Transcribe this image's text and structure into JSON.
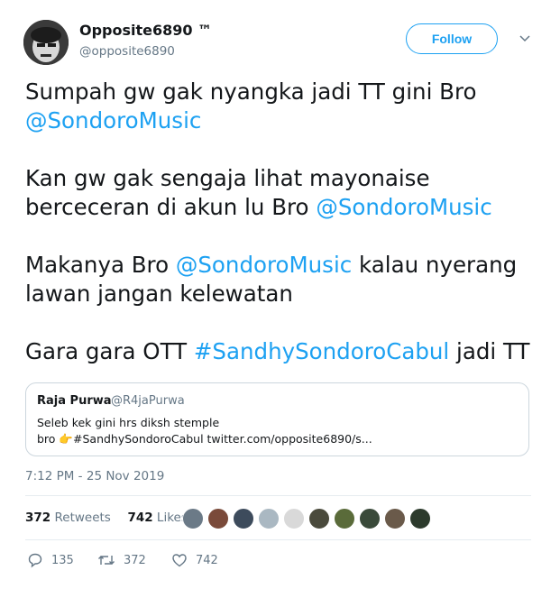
{
  "author": {
    "display_name": "Opposite6890 ™",
    "handle": "@opposite6890",
    "avatar_icon": "profile-photo"
  },
  "follow_label": "Follow",
  "tweet": {
    "line1": "Sumpah gw gak nyangka jadi TT gini Bro",
    "line1_mention": "@SondoroMusic",
    "line2a": "Kan gw gak sengaja lihat mayonaise",
    "line2b": "berceceran di akun lu Bro ",
    "line2_mention": "@SondoroMusic",
    "line3a": "Makanya Bro ",
    "line3_mention": "@SondoroMusic",
    "line3b": " kalau nyerang",
    "line3c": "lawan jangan kelewatan",
    "line4a": "Gara gara OTT ",
    "line4_hashtag": "#SandhySondoroCabul",
    "line4b": "  jadi TT"
  },
  "quoted": {
    "name": "Raja Purwa",
    "handle": "@R4jaPurwa",
    "line1": "Seleb kek gini hrs diksh stemple",
    "line2_prefix": "bro ",
    "emoji": "👉",
    "line2_rest": "#SandhySondoroCabul twitter.com/opposite6890/s..."
  },
  "timestamp": "7:12 PM - 25 Nov 2019",
  "stats": {
    "retweets_count": "372",
    "retweets_label": "Retweets",
    "likes_count": "742",
    "likes_label": "Likes"
  },
  "liker_colors": [
    "#6b7a87",
    "#7a4a3a",
    "#3d4b5c",
    "#aab8c2",
    "#d9d9d9",
    "#4a4a3c",
    "#5a6b3a",
    "#3a4a3a",
    "#6a5a4a",
    "#2c3a2c"
  ],
  "actions": {
    "reply_count": "135",
    "retweet_count": "372",
    "like_count": "742"
  },
  "colors": {
    "accent": "#1da1f2",
    "muted": "#657786"
  }
}
